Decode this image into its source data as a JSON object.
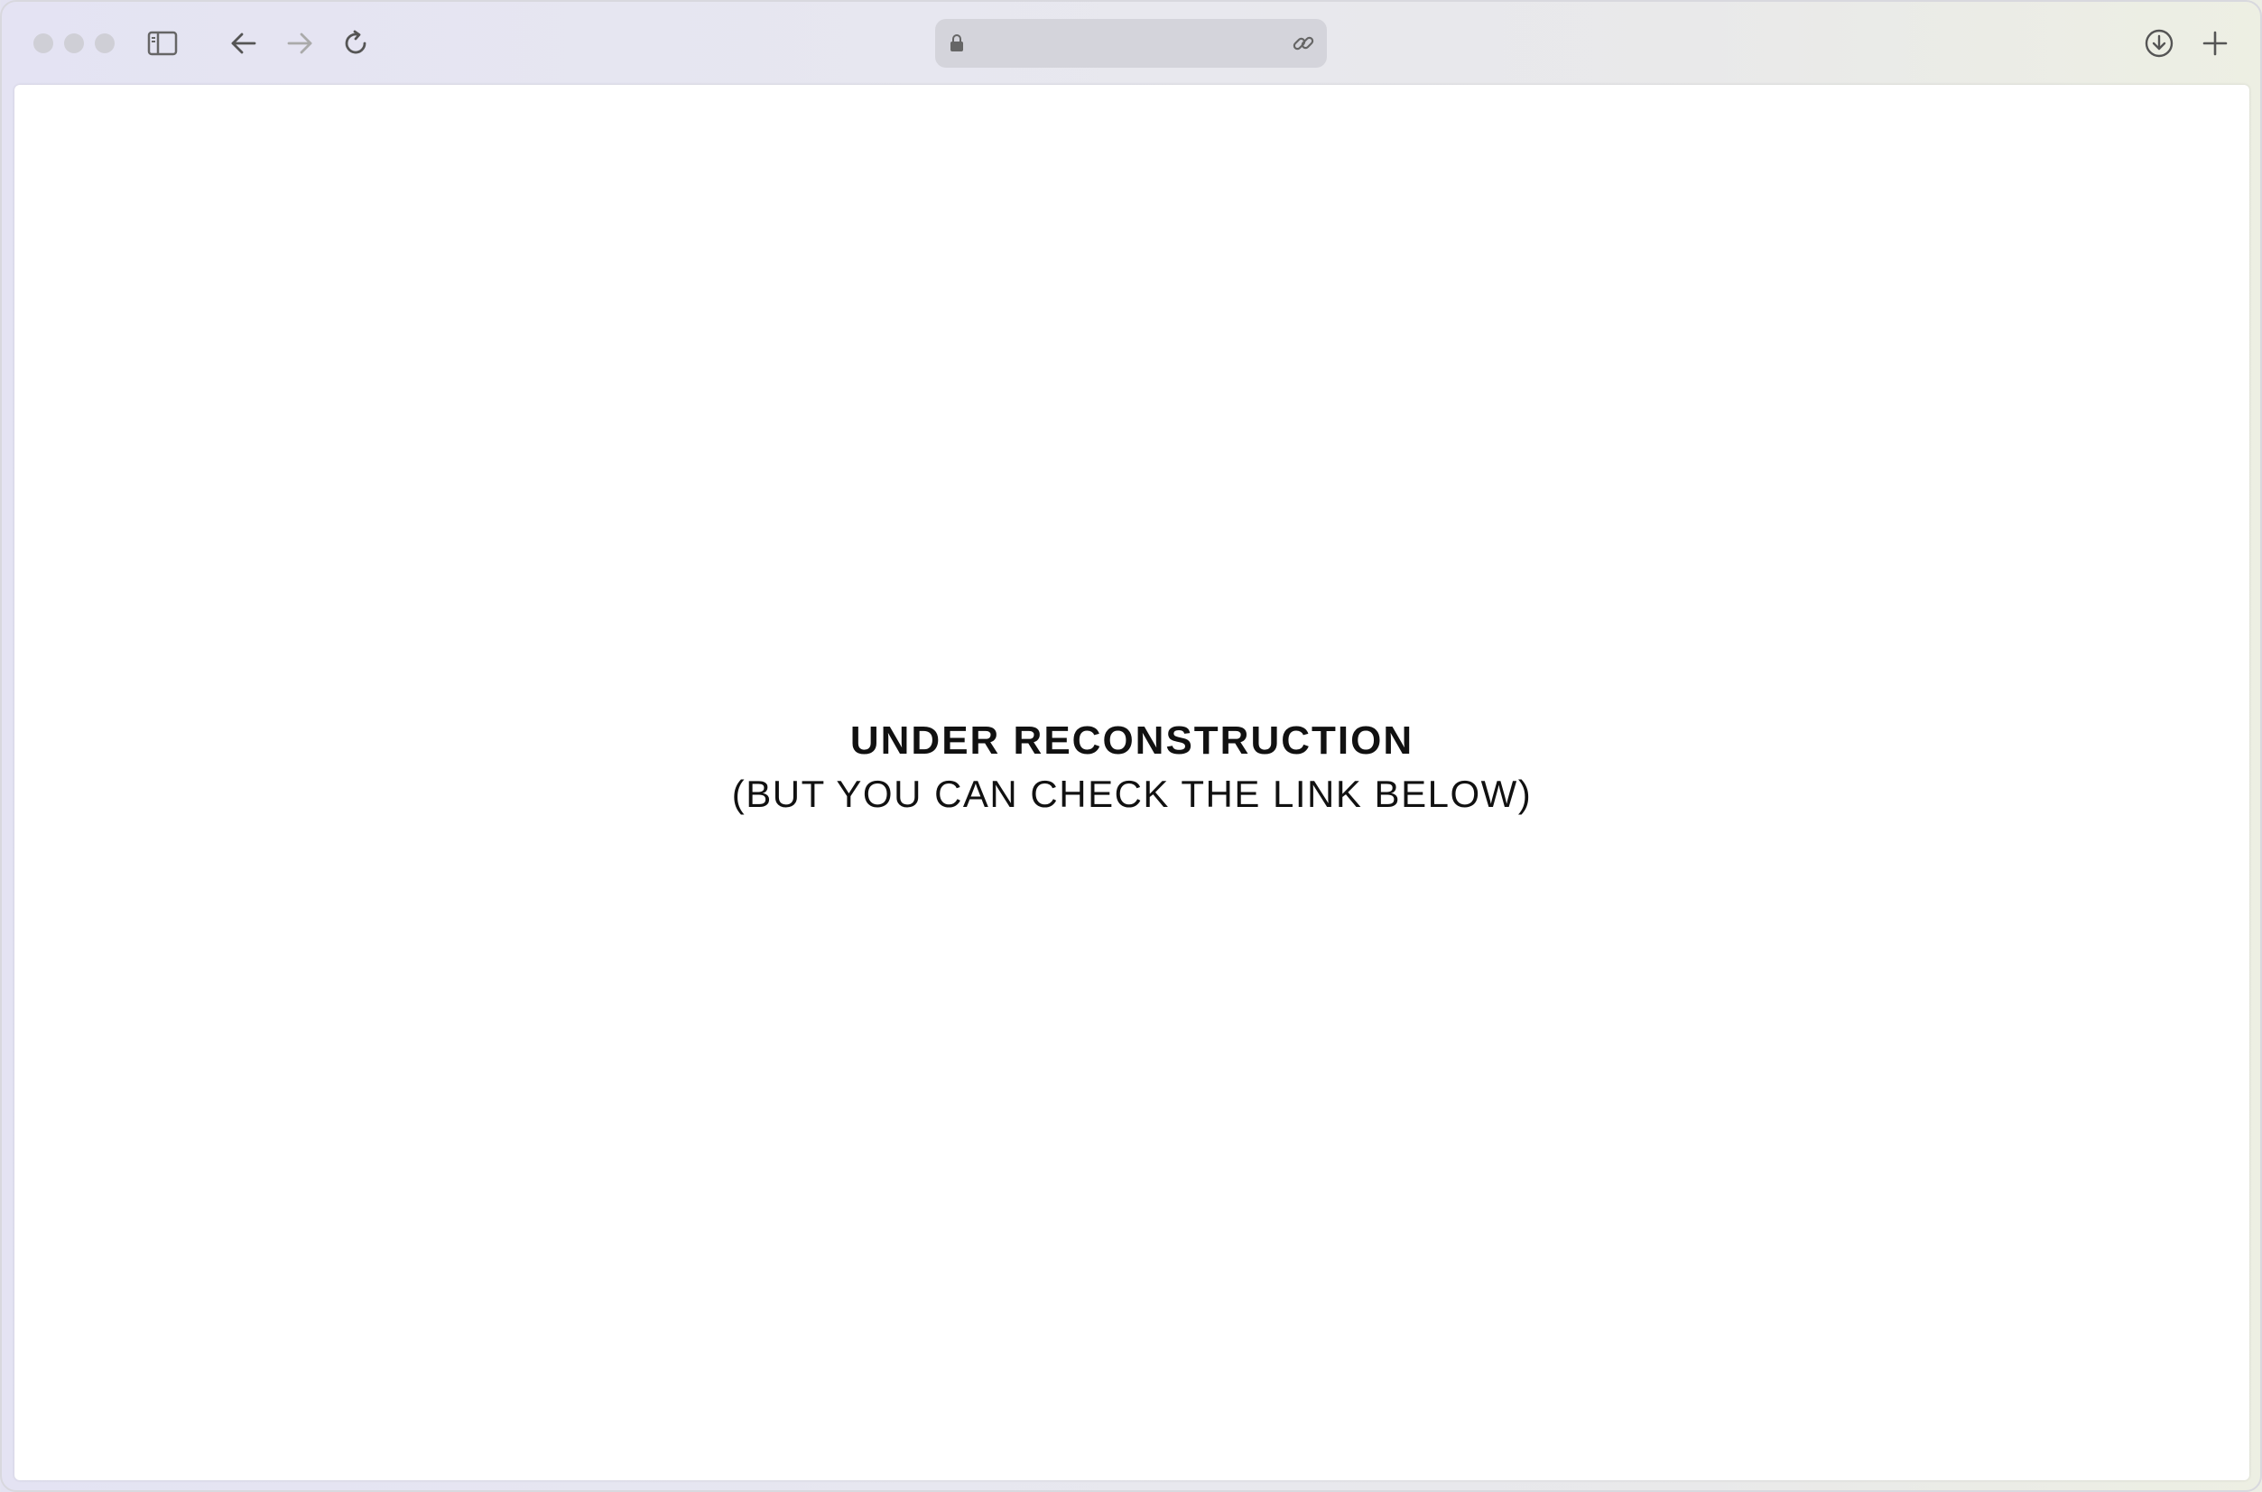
{
  "browser": {
    "address_bar": {
      "url": ""
    },
    "icons": {
      "sidebar": "sidebar-icon",
      "back": "arrow-left-icon",
      "forward": "arrow-right-icon",
      "reload": "reload-icon",
      "lock": "lock-icon",
      "link": "link-icon",
      "downloads": "download-icon",
      "new_tab": "plus-icon"
    },
    "colors": {
      "toolbar": "#e7e7f0",
      "address_bar": "#d4d4db",
      "traffic_light": "#cfcfd6"
    }
  },
  "page": {
    "heading": "UNDER RECONSTRUCTION",
    "subheading": "(BUT YOU CAN CHECK THE LINK BELOW)"
  }
}
